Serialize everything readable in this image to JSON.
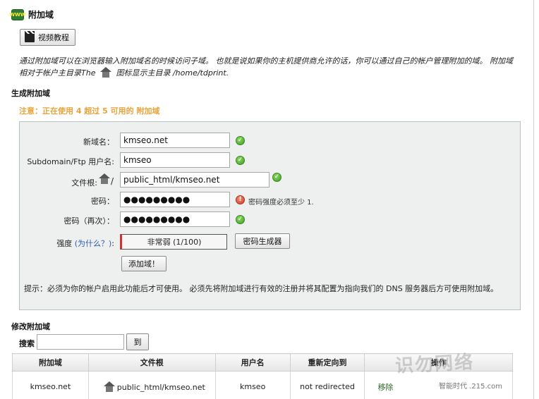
{
  "header": {
    "title": "附加域",
    "icon": "www-domain-icon"
  },
  "video_button": {
    "label": "视频教程",
    "icon": "clapperboard-icon"
  },
  "intro": {
    "part1": "通过附加域可以在浏览器输入附加域名的时候访问子域。 也就是说如果你的主机提供商允许的话，你可以通过自己的帐户管理附加的域。 附加域相对于帐户主目录The",
    "part2": "图标显示主目录 /home/tdprint."
  },
  "create_section": {
    "title": "生成附加域",
    "notice": "注意：正在使用 4 超过 5 可用的 附加域"
  },
  "form": {
    "new_domain_label": "新域名：",
    "new_domain_value": "kmseo.net",
    "subdomain_label": "Subdomain/Ftp 用户名:",
    "subdomain_value": "kmseo",
    "docroot_label": "文件根:",
    "docroot_prefix": "/",
    "docroot_value": "public_html/kmseo.net",
    "password_label": "密码：",
    "password_value": "●●●●●●●●●",
    "password_error": "密码强度必须至少 1.",
    "password2_label": "密码（再次）：",
    "password2_value": "●●●●●●●●●",
    "strength_label": "强度",
    "strength_why": "(为什么？)",
    "strength_colon": ":",
    "strength_value": "非常弱 (1/100)",
    "generator_button": "密码生成器",
    "add_button": "添加域！",
    "tip": "提示：必须为你的帐户启用此功能后才可使用。 必须先将附加域进行有效的注册并将其配置为指向我们的 DNS 服务器后方可使用附加域。"
  },
  "modify_section": {
    "title": "修改附加域"
  },
  "search": {
    "label": "搜索",
    "value": "",
    "button": "到"
  },
  "table": {
    "columns": [
      "附加域",
      "文件根",
      "用户名",
      "重新定向到",
      "操作"
    ],
    "rows": [
      {
        "domain": "kmseo.net",
        "docroot": "public_html/kmseo.net",
        "user": "kmseo",
        "redirect": "not redirected",
        "action": "移除"
      }
    ]
  },
  "watermark": {
    "text": "识勿网络",
    "sub": "智能时代 .215.com"
  }
}
